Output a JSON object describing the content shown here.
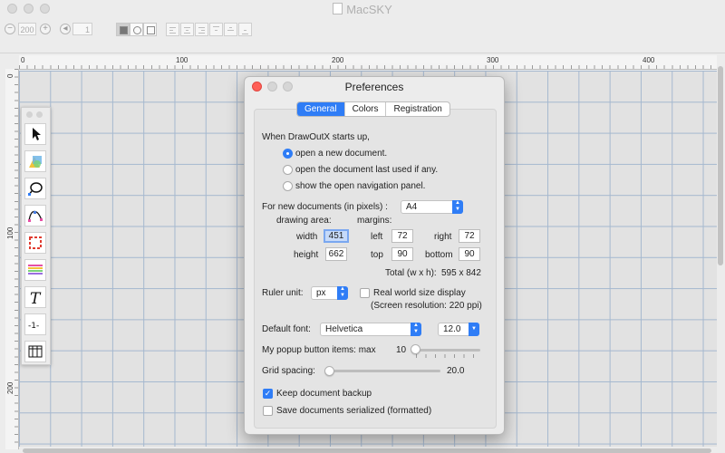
{
  "window": {
    "title": "MacSKY"
  },
  "toolbar": {
    "zoom_value": "200",
    "page_value": "1"
  },
  "ruler": {
    "h_labels": [
      "0",
      "100",
      "200",
      "300",
      "400"
    ],
    "v_labels": [
      "0",
      "100",
      "200"
    ]
  },
  "palette": {
    "tools": [
      "arrow-tool",
      "shape-tool",
      "curve-tool",
      "bezier-tool",
      "selection-frame-tool",
      "lines-tool",
      "text-tool",
      "numbering-tool",
      "table-tool"
    ]
  },
  "dialog": {
    "title": "Preferences",
    "tabs": [
      "General",
      "Colors",
      "Registration"
    ],
    "active_tab": "General",
    "startup_label": "When DrawOutX starts up,",
    "startup_options": [
      "open a new document.",
      "open the document last used if any.",
      "show the open navigation panel."
    ],
    "startup_selected": "open a new document.",
    "new_doc_label": "For new documents (in pixels) :",
    "paper_size": "A4",
    "drawing_area_label": "drawing area:",
    "margins_label": "margins:",
    "width_label": "width",
    "width_value": "451",
    "height_label": "height",
    "height_value": "662",
    "left_label": "left",
    "left_value": "72",
    "right_label": "right",
    "right_value": "72",
    "top_label": "top",
    "top_value": "90",
    "bottom_label": "bottom",
    "bottom_value": "90",
    "total_label": "Total (w x h):",
    "total_value": "595 x 842",
    "ruler_unit_label": "Ruler unit:",
    "ruler_unit": "px",
    "real_world_label": "Real world size display",
    "real_world_checked": false,
    "screen_resolution": "(Screen resolution: 220 ppi)",
    "default_font_label": "Default font:",
    "default_font": "Helvetica",
    "font_size": "12.0",
    "popup_items_label": "My popup button items: max",
    "popup_items_value": "10",
    "popup_items_fraction": 0.0,
    "grid_spacing_label": "Grid spacing:",
    "grid_spacing_value": "20.0",
    "grid_spacing_fraction": 0.0,
    "keep_backup_label": "Keep document backup",
    "keep_backup_checked": true,
    "serialized_label": "Save documents serialized (formatted)",
    "serialized_checked": false
  },
  "colors": {
    "accent": "#2f7df6",
    "grid": "#a5b8cf",
    "close": "#ff5f57"
  }
}
